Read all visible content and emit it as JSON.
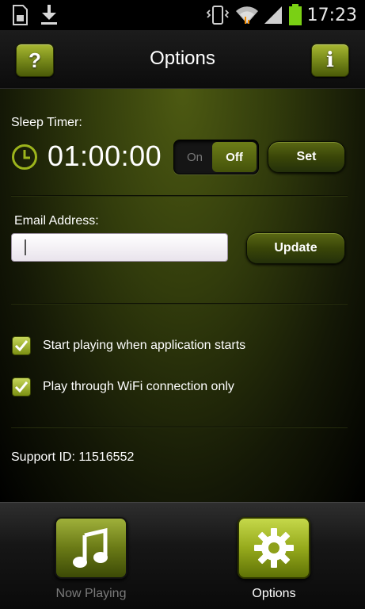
{
  "status_bar": {
    "time": "17:23",
    "icons": [
      "sd-card-icon",
      "download-icon",
      "vibrate-icon",
      "wifi-icon",
      "signal-icon",
      "battery-icon"
    ]
  },
  "header": {
    "title": "Options",
    "help_label": "?",
    "info_label": "i"
  },
  "sleep_timer": {
    "label": "Sleep Timer:",
    "value": "01:00:00",
    "toggle_on": "On",
    "toggle_off": "Off",
    "toggle_state": "Off",
    "set_label": "Set"
  },
  "email": {
    "label": "Email Address:",
    "value": "",
    "update_label": "Update"
  },
  "options": [
    {
      "label": "Start playing when application starts",
      "checked": true
    },
    {
      "label": "Play through WiFi connection only",
      "checked": true
    }
  ],
  "support": {
    "text": "Support ID: 11516552"
  },
  "tabs": [
    {
      "label": "Now Playing",
      "active": false,
      "icon": "music-note-icon"
    },
    {
      "label": "Options",
      "active": true,
      "icon": "gear-icon"
    }
  ],
  "colors": {
    "accent": "#8fa21e",
    "accent_light": "#c5d84a",
    "panel_dark": "#141806"
  }
}
